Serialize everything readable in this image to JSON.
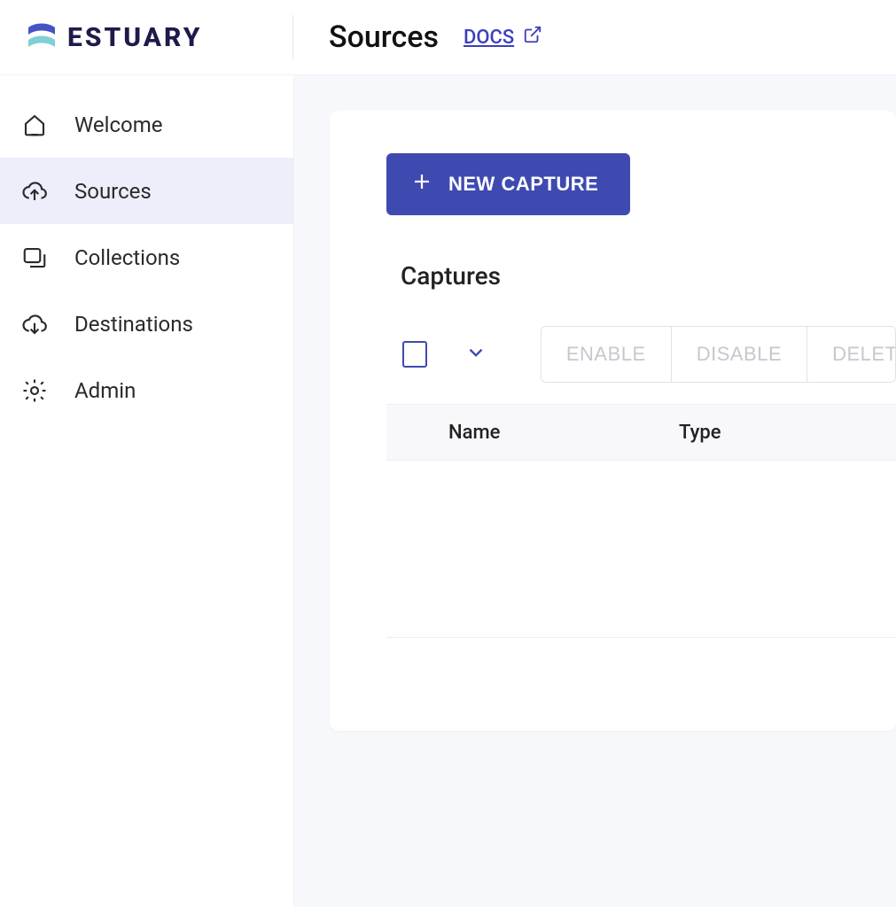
{
  "brand": {
    "name": "ESTUARY"
  },
  "header": {
    "page_title": "Sources",
    "docs_label": "DOCS"
  },
  "sidebar": {
    "items": [
      {
        "id": "welcome",
        "label": "Welcome",
        "icon": "home-icon",
        "active": false
      },
      {
        "id": "sources",
        "label": "Sources",
        "icon": "cloud-upload-icon",
        "active": true
      },
      {
        "id": "collections",
        "label": "Collections",
        "icon": "collections-icon",
        "active": false
      },
      {
        "id": "destinations",
        "label": "Destinations",
        "icon": "cloud-download-icon",
        "active": false
      },
      {
        "id": "admin",
        "label": "Admin",
        "icon": "gear-icon",
        "active": false
      }
    ]
  },
  "main": {
    "new_capture_label": "NEW CAPTURE",
    "section_title": "Captures",
    "actions": {
      "enable": "ENABLE",
      "disable": "DISABLE",
      "delete": "DELETE"
    },
    "table": {
      "columns": {
        "name": "Name",
        "type": "Type"
      },
      "rows": []
    }
  }
}
